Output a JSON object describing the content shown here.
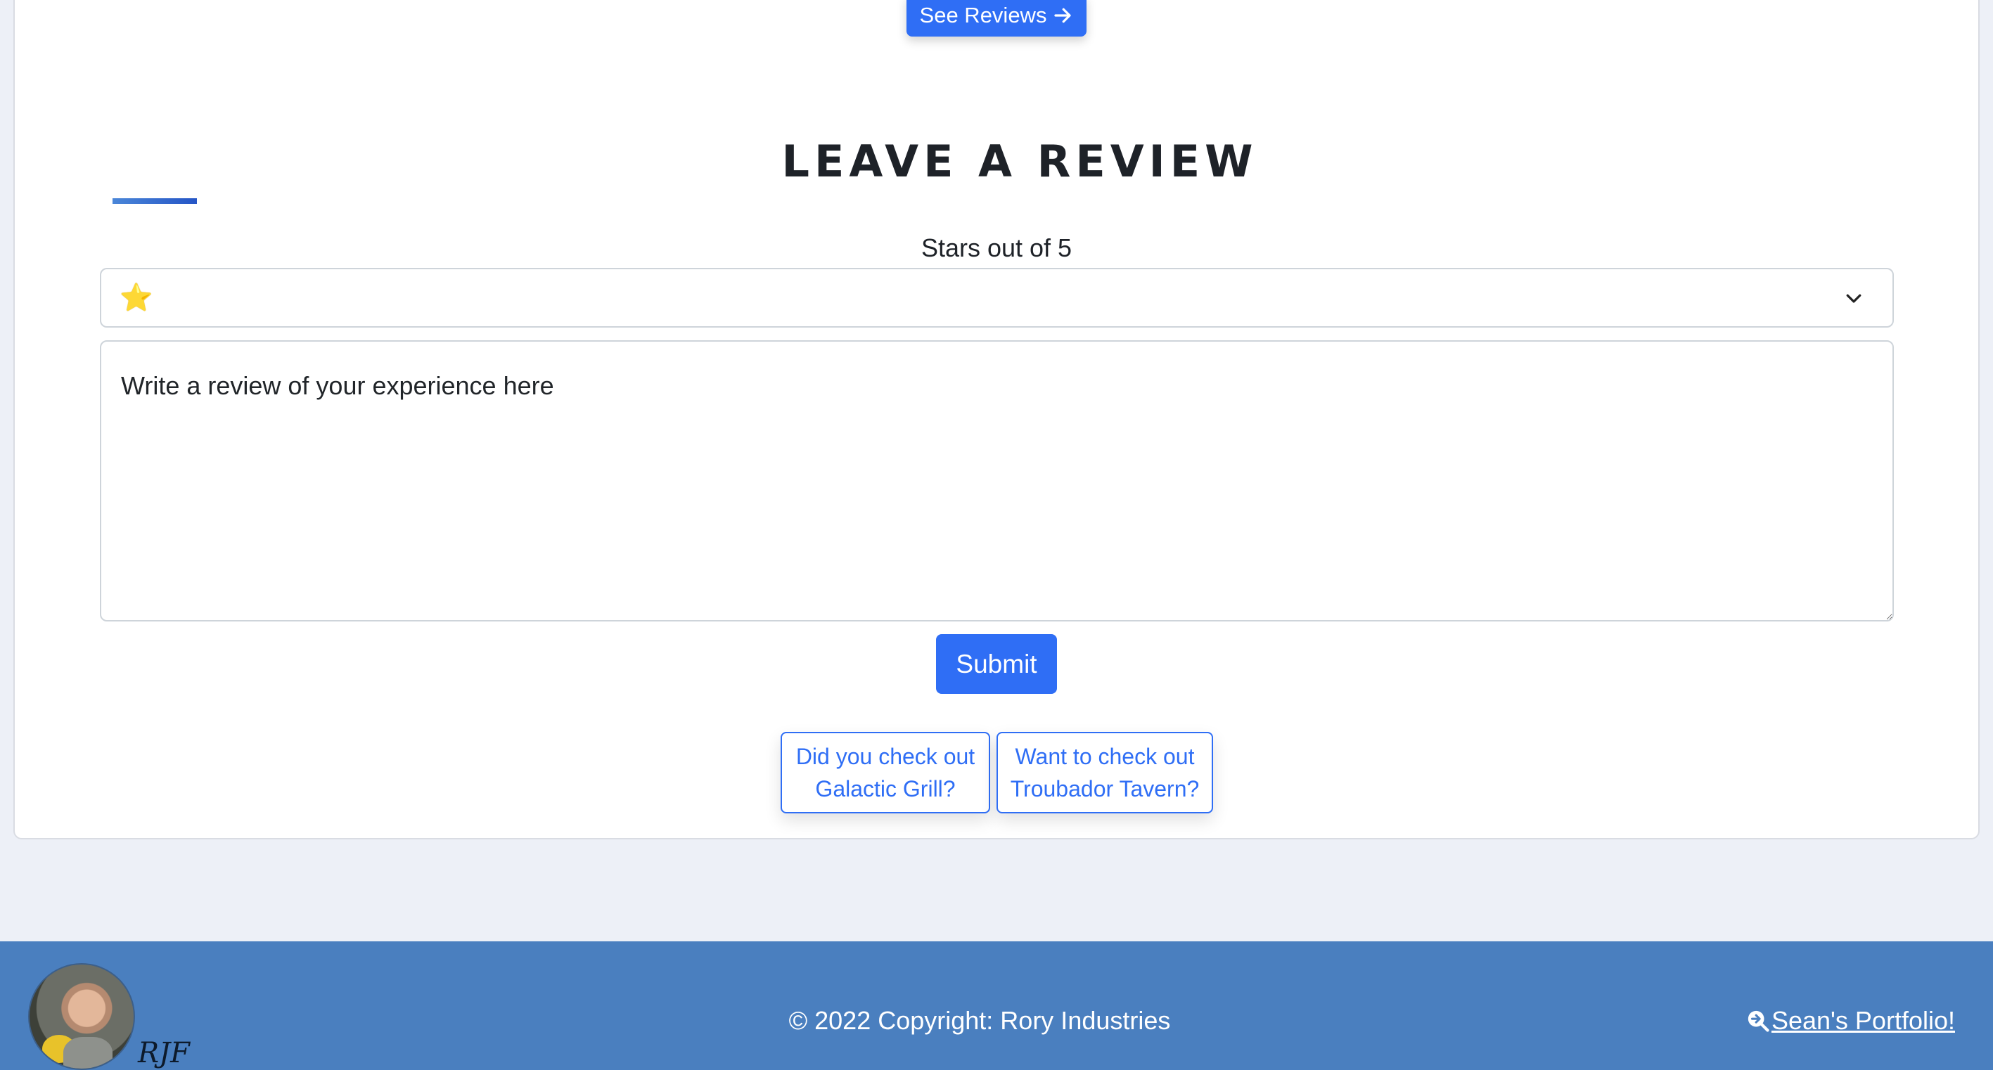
{
  "top_button": {
    "label": "See Reviews",
    "icon": "arrow-right-icon"
  },
  "review_section": {
    "heading": "LEAVE A REVIEW",
    "stars_label": "Stars out of 5",
    "star_select": {
      "selected_value": "⭐",
      "icon": "chevron-down-icon"
    },
    "review_text": {
      "placeholder": "Write a review of your experience here"
    },
    "submit_label": "Submit",
    "suggestions": [
      {
        "line1": "Did you check out",
        "line2": "Galactic Grill?"
      },
      {
        "line1": "Want to check out",
        "line2": "Troubador Tavern?"
      }
    ]
  },
  "footer": {
    "logo_text": "RJF",
    "copyright": "© 2022 Copyright: Rory Industries",
    "portfolio_link": {
      "label": "Sean's Portfolio!",
      "icon": "search-circle-arrow-icon"
    }
  },
  "colors": {
    "primary": "#2f6ef5",
    "footer_bg": "#4a7fbf",
    "page_bg": "#edf0f7"
  }
}
